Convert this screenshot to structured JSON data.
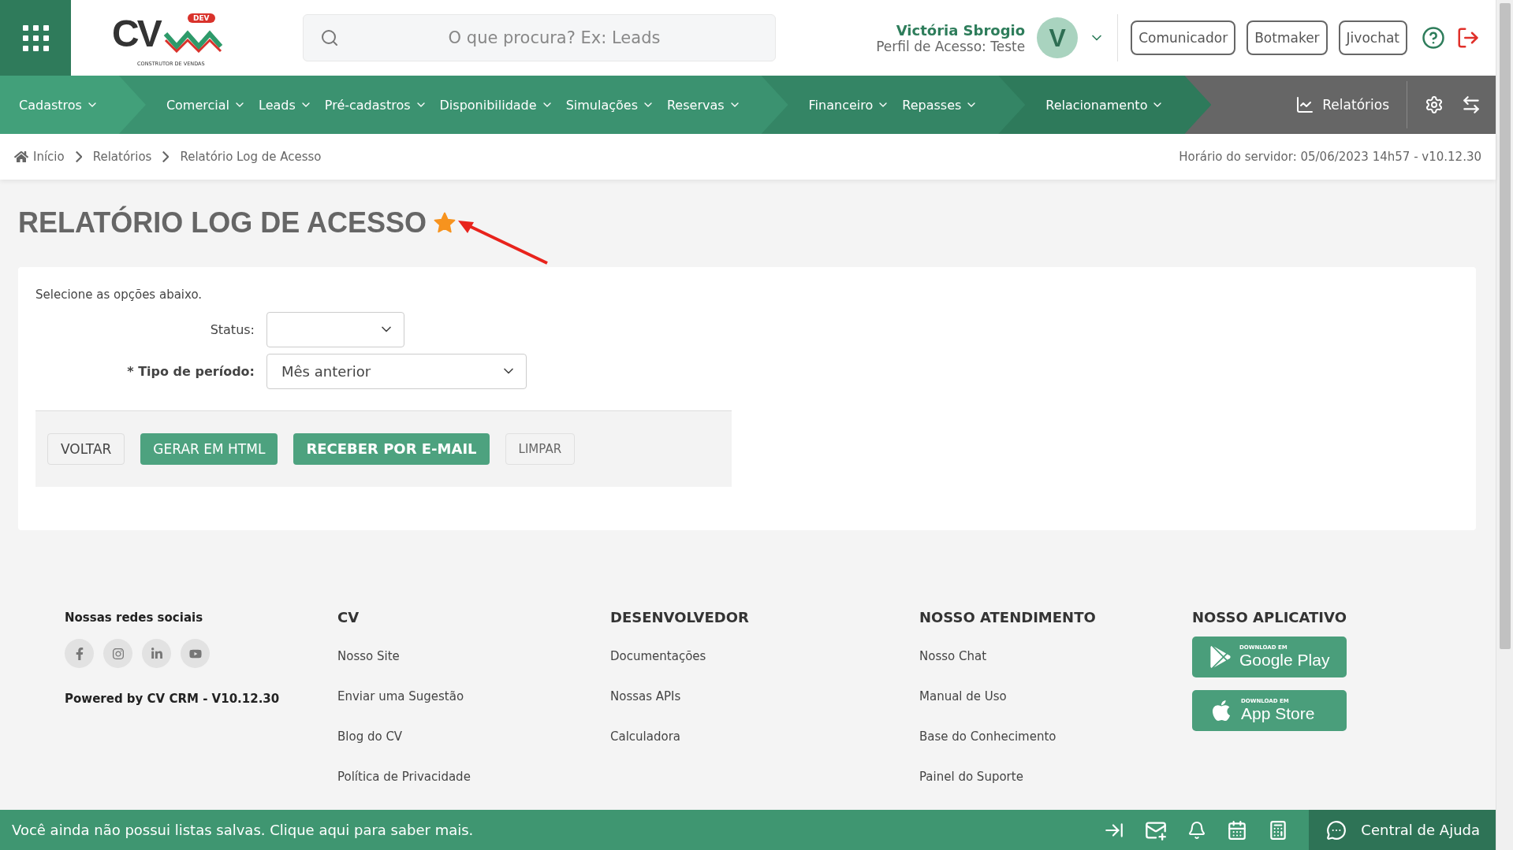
{
  "logo": {
    "text": "CV",
    "badge": "DEV",
    "tagline": "CONSTRUTOR DE VENDAS"
  },
  "search": {
    "placeholder": "O que procura? Ex: Leads"
  },
  "user": {
    "name": "Victória Sbrogio",
    "profile": "Perfil de Acesso: Teste",
    "initial": "V"
  },
  "header_buttons": [
    "Comunicador",
    "Botmaker",
    "Jivochat"
  ],
  "nav": [
    {
      "color": "#42a07a",
      "items": [
        "Cadastros"
      ]
    },
    {
      "color": "#3b9270",
      "items": [
        "Comercial",
        "Leads",
        "Pré-cadastros",
        "Disponibilidade",
        "Simulações",
        "Reservas"
      ]
    },
    {
      "color": "#348565",
      "items": [
        "Financeiro",
        "Repasses"
      ]
    },
    {
      "color": "#2e7a5b",
      "items": [
        "Relacionamento"
      ]
    }
  ],
  "nav_right": {
    "label": "Relatórios"
  },
  "breadcrumb": [
    "Início",
    "Relatórios",
    "Relatório Log de Acesso"
  ],
  "server_time": "Horário do servidor: 05/06/2023 14h57 - v10.12.30",
  "page": {
    "title": "RELATÓRIO LOG DE ACESSO",
    "favorited": true
  },
  "form": {
    "intro": "Selecione as opções abaixo.",
    "fields": [
      {
        "label": "Status:",
        "required": false,
        "wide": false
      },
      {
        "label": "* Tipo de período:",
        "required": true,
        "value": "Mês anterior",
        "wide": true
      }
    ],
    "buttons": [
      {
        "label": "VOLTAR",
        "kind": "default"
      },
      {
        "label": "GERAR EM HTML",
        "kind": "primary"
      },
      {
        "label": "RECEBER POR E-MAIL",
        "kind": "primary-bold"
      },
      {
        "label": "LIMPAR",
        "kind": "light"
      }
    ]
  },
  "footer": {
    "social_title": "Nossas redes sociais",
    "powered": "Powered by CV CRM - V10.12.30",
    "columns": [
      {
        "title": "CV",
        "links": [
          "Nosso Site",
          "Enviar uma Sugestão",
          "Blog do CV",
          "Política de Privacidade"
        ]
      },
      {
        "title": "DESENVOLVEDOR",
        "links": [
          "Documentações",
          "Nossas APIs",
          "Calculadora"
        ]
      },
      {
        "title": "NOSSO ATENDIMENTO",
        "links": [
          "Nosso Chat",
          "Manual de Uso",
          "Base do Conhecimento",
          "Painel do Suporte"
        ]
      }
    ],
    "app_title": "NOSSO APLICATIVO",
    "stores": [
      {
        "kind": "google",
        "small": "DOWNLOAD EM",
        "name": "Google Play"
      },
      {
        "kind": "apple",
        "small": "DOWNLOAD EM",
        "name": "App Store"
      }
    ]
  },
  "bottom_bar": {
    "message": "Você ainda não possui listas salvas. Clique aqui para saber mais.",
    "help": "Central de Ajuda"
  }
}
